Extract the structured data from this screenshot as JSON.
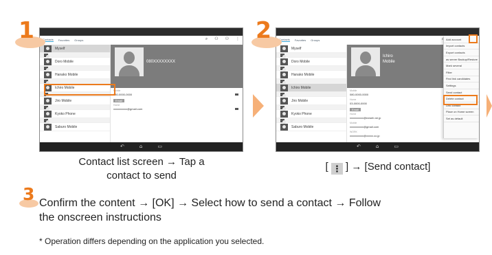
{
  "steps": [
    {
      "number": "1",
      "caption_line1": "Contact list screen → Tap a",
      "caption_line2": "contact to send",
      "screen": {
        "tabs": [
          "Contacts",
          "Favorites",
          "Groups"
        ],
        "toolbar_icons": [
          "⌕",
          "⚇",
          "⚇",
          "⋮"
        ],
        "contacts": [
          {
            "name": "Myself",
            "group": false,
            "selected": true
          },
          {
            "name": "",
            "group": true,
            "selected": false
          },
          {
            "name": "Doro Mobile",
            "group": false,
            "selected": false
          },
          {
            "name": "",
            "group": true,
            "selected": false
          },
          {
            "name": "Hanako Mobile",
            "group": false,
            "selected": false
          },
          {
            "name": "",
            "group": true,
            "selected": false
          },
          {
            "name": "Ichiro Mobile",
            "group": false,
            "selected": false
          },
          {
            "name": "",
            "group": true,
            "selected": false
          },
          {
            "name": "Jiro Mobile",
            "group": false,
            "selected": false
          },
          {
            "name": "",
            "group": true,
            "selected": false
          },
          {
            "name": "Kyoko Phone",
            "group": false,
            "selected": false
          },
          {
            "name": "",
            "group": true,
            "selected": false
          },
          {
            "name": "Saburo Mobile",
            "group": false,
            "selected": false
          }
        ],
        "hero_name": "080XXXXXXXX",
        "fields": {
          "mobile_label": "Mobile",
          "mobile_value": "080-0000-0000",
          "email_section": "Email",
          "home_label": "Home",
          "home_value": "xxxxxxxxxx@gmail.com"
        },
        "nav_icons": [
          "↶",
          "⌂",
          "▭"
        ]
      }
    },
    {
      "number": "2",
      "caption_prefix": "[",
      "caption_icon": "⋮",
      "caption_suffix": "] → [Send contact]",
      "screen": {
        "tabs": [
          "Contacts",
          "Favorites",
          "Groups"
        ],
        "toolbar_icons": [
          "⌕",
          "⚇",
          "⚇",
          "⋮"
        ],
        "contacts": [
          {
            "name": "Myself",
            "group": false,
            "selected": false
          },
          {
            "name": "",
            "group": true,
            "selected": false
          },
          {
            "name": "Doro Mobile",
            "group": false,
            "selected": false
          },
          {
            "name": "",
            "group": true,
            "selected": false
          },
          {
            "name": "Hanako Mobile",
            "group": false,
            "selected": false
          },
          {
            "name": "",
            "group": true,
            "selected": false
          },
          {
            "name": "Ichiro Mobile",
            "group": false,
            "selected": true
          },
          {
            "name": "",
            "group": true,
            "selected": false
          },
          {
            "name": "Jiro Mobile",
            "group": false,
            "selected": false
          },
          {
            "name": "",
            "group": true,
            "selected": false
          },
          {
            "name": "Kyoko Phone",
            "group": false,
            "selected": false
          },
          {
            "name": "",
            "group": true,
            "selected": false
          },
          {
            "name": "Saburo Mobile",
            "group": false,
            "selected": false
          }
        ],
        "hero_name_line1": "Ichiro",
        "hero_name_line2": "Mobile",
        "fields": {
          "mobile_label": "Mobile",
          "mobile_value": "080-0000-0000",
          "home_label": "Home",
          "home_value": "03-0000-0000",
          "email_section": "Email",
          "email1_label": "Home",
          "email1_value": "xxxxxxxxxx@ezweb.ne.jp",
          "email2_label": "Mobile",
          "email2_value": "xxxxxxxxxx@gmail.com",
          "email3_label": "WORK",
          "email3_value": "xxxxxxxxxx@xxxxx.co.jp"
        },
        "menu": [
          "Add account",
          "Import contacts",
          "Export contacts",
          "as server Backup/Restore",
          "Mark several",
          "Filter",
          "Find link candidates",
          "Settings",
          "Send contact",
          "Delete contact",
          "Link contact",
          "Place on Home screen",
          "Set as default"
        ],
        "nav_icons": [
          "↶",
          "⌂",
          "▭"
        ]
      }
    },
    {
      "number": "3",
      "line1": "Confirm the content → [OK] → Select how to send a contact → Follow",
      "line2": "the onscreen instructions",
      "note": "* Operation differs depending on the application you selected."
    }
  ],
  "colors": {
    "accent": "#ec7a1c",
    "accent_light": "#f7c9a3",
    "arrow": "#f6b078"
  }
}
